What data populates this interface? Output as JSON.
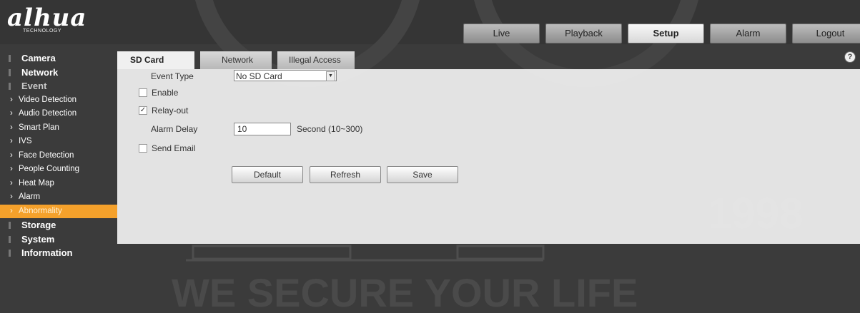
{
  "brand": {
    "name": "alhua",
    "tagline": "TECHNOLOGY"
  },
  "topnav": [
    "Live",
    "Playback",
    "Setup",
    "Alarm",
    "Logout"
  ],
  "sidebar": {
    "camera": "Camera",
    "network": "Network",
    "event": "Event",
    "items": [
      "Video Detection",
      "Audio Detection",
      "Smart Plan",
      "IVS",
      "Face Detection",
      "People Counting",
      "Heat Map",
      "Alarm",
      "Abnormality"
    ],
    "storage": "Storage",
    "system": "System",
    "information": "Information"
  },
  "subtabs": [
    "SD Card",
    "Network",
    "Illegal Access"
  ],
  "form": {
    "event_type_label": "Event Type",
    "event_type_value": "No SD Card",
    "enable_label": "Enable",
    "enable_checked": false,
    "relay_label": "Relay-out",
    "relay_checked": true,
    "alarm_delay_label": "Alarm Delay",
    "alarm_delay_value": "10",
    "alarm_delay_unit": "Second (10~300)",
    "send_email_label": "Send Email",
    "send_email_checked": false
  },
  "buttons": {
    "default": "Default",
    "refresh": "Refresh",
    "save": "Save"
  },
  "help_icon": "?",
  "background": {
    "year": "1998",
    "slogan": "WE SECURE YOUR LIFE"
  },
  "colors": {
    "accent": "#f5a12b",
    "dark": "#3a3a3a",
    "panel": "#f0f0f0"
  }
}
